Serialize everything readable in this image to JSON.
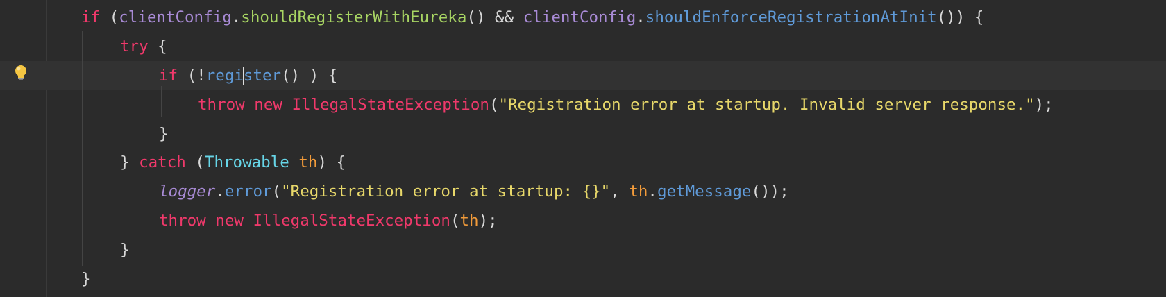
{
  "code": {
    "line1": {
      "kw_if": "if",
      "open": " (",
      "field1": "clientConfig",
      "dot1": ".",
      "method1": "shouldRegisterWithEureka",
      "mid": "() && ",
      "field2": "clientConfig",
      "dot2": ".",
      "method2": "shouldEnforceRegistrationAtInit",
      "close": "()) {"
    },
    "line2": {
      "kw_try": "try",
      "brace": " {"
    },
    "line3": {
      "kw_if": "if",
      "open": " (!",
      "method_a": "regi",
      "method_b": "ster",
      "close": "() ) {"
    },
    "line4": {
      "kw_throw": "throw",
      "kw_new": " new ",
      "type": "IllegalStateException",
      "open": "(",
      "string": "\"Registration error at startup. Invalid server response.\"",
      "close": ");"
    },
    "line5": {
      "brace": "}"
    },
    "line6": {
      "brace": "} ",
      "kw_catch": "catch",
      "open": " (",
      "type": "Throwable",
      "param": "th",
      "close": ") {"
    },
    "line7": {
      "logger": "logger",
      "dot": ".",
      "method": "error",
      "open": "(",
      "string": "\"Registration error at startup: {}\"",
      "comma": ", ",
      "param": "th",
      "dot2": ".",
      "method2": "getMessage",
      "close": "());"
    },
    "line8": {
      "kw_throw": "throw",
      "kw_new": " new ",
      "type": "IllegalStateException",
      "open": "(",
      "param": "th",
      "close": ");"
    },
    "line9": {
      "brace": "}"
    },
    "line10": {
      "brace": "}"
    }
  },
  "icons": {
    "intention": "lightbulb-icon"
  }
}
